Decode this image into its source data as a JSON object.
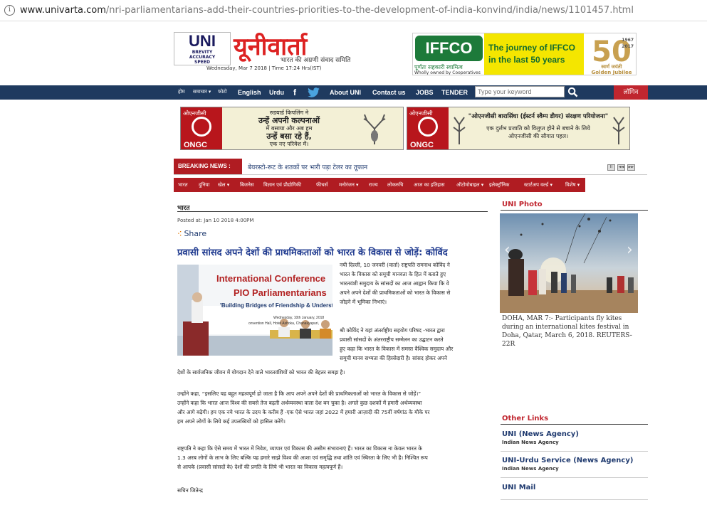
{
  "browser": {
    "url_host": "www.univarta.com",
    "url_path": "/nri-parliamentarians-add-their-countries-priorities-to-the-development-of-india-konvind/india/news/1101457.html"
  },
  "header": {
    "uni_logo": "UNI",
    "uni_slogan_lines": [
      "BREVITY",
      "ACCURACY",
      "SPEED"
    ],
    "hindi_logo": "यूनीवार्ता",
    "hindi_tagline": "भारत की अग्रणी संवाद समिति",
    "date_line": "Wednesday, Mar 7 2018 | Time 17:24 Hrs(IST)"
  },
  "iffco_ad": {
    "logo": "IFFCO",
    "sub1": "पूर्णतः सहकारी स्वामित्व",
    "sub2": "Wholly owned by Cooperatives",
    "headline_line1": "The journey of IFFCO",
    "headline_line2": "in the last 50 years",
    "fifty": "50",
    "year_start": "1967",
    "year_end": "2017",
    "golden_hindi": "स्वर्ण जयंती",
    "golden_en": "Golden Jubilee"
  },
  "nav": {
    "home": "होम",
    "samachar": "समाचार ▾",
    "photo": "फोटो",
    "english": "English",
    "urdu": "Urdu",
    "about": "About UNI",
    "contact": "Contact us",
    "jobs": "JOBS",
    "tender": "TENDER",
    "search_placeholder": "Type your keyword",
    "login": "लॉगिन"
  },
  "ads": {
    "ongc_left_label": "ओएनजीसी",
    "ongc_brand": "ONGC",
    "ongc1_lines": [
      "रुडयार्ड किपलिंग ने",
      "उन्हें अपनी कल्पनाओं",
      "में बसाया और अब हम",
      "उन्हें बसा रहे हैं,",
      "एक नए परिवेश में।"
    ],
    "ongc2_lines": [
      "\"ओएनजीसी बारासिंघा (ईस्टर्न स्वैम्प डीयर) संरक्षण परियोजना\"",
      "एक दुर्लभ प्रजाति को विलुप्त होने से बचाने के लिये",
      "ओएनजीसी की सौगात पहल।"
    ]
  },
  "breaking": {
    "label": "BREAKING NEWS :",
    "text": "बेयरस्टो-रूट के शतकों पर भारी पड़ा टेलर का तूफान",
    "controls": [
      "II",
      "◄◄",
      "►►"
    ]
  },
  "subnav": [
    "भारत",
    "दुनिया",
    "खेल ▾",
    "बिजनेस",
    "विज्ञान एवं प्रौद्योगिकी",
    "फीचर्स",
    "मनोरंजन ▾",
    "राज्य",
    "लोकरुचि",
    "आज का इतिहास",
    "ऑटोमोबाइल ▾",
    "इलेक्ट्रॉनिक",
    "स्टार्टअप वर्ल्ड ▾",
    "विशेष ▾"
  ],
  "article": {
    "section": "भारत",
    "posted": "Posted at: Jan 10 2018 4:00PM",
    "share": "Share",
    "title": "प्रवासी सांसद अपने देशों की प्राथमिकताओं को भारत के विकास से जोड़ें: कोविंद",
    "photo_banner_line1": "International Conference",
    "photo_banner_line2": "PIO Parliamentarians",
    "photo_banner_line3": "'Building Bridges of Friendship & Understa",
    "photo_banner_line4": "Wednesday, 10th January, 2018",
    "photo_banner_line5": "onvention Hall, Hotel Ashoka, Chanakyapuri,",
    "para1_lines": [
      "नयी दिल्ली, 10 जनवरी (वार्ता) राष्ट्रपति रामनाथ कोविंद ने",
      "भारत के विकास को समूची मानवता के हित में बताते हुए",
      "भारतवंशी समुदाय के सांसदों का आज आह्वान किया कि वे",
      "अपने अपने देशों की प्राथमिकताओं को भारत के विकास से",
      "जोड़ने में भूमिका निभाएं।"
    ],
    "para2_lines": [
      "श्री कोविंद ने यहां अंतर्राष्ट्रीय सहयोग परिषद -भारत द्वारा",
      "प्रवासी सांसदों के अंतरराष्ट्रीय सम्मेलन का उद्घाटन करते",
      "हुए कहा कि भारत के विकास में समस्त वैश्विक समुदाय और",
      "समूची मानव सभ्यता की हिस्सेदारी है। सांसद होकर अपने"
    ],
    "para2_last": "देशों के सार्वजनिक जीवन में योगदान देने वाले भारतवंशियों को भारत की बेहतर समझ है।",
    "para3_lines": [
      "उन्होंने कहा, “इसलिए यह बहुत महत्वपूर्ण हो जाता है कि आप अपने अपने देशों की प्राथमिकताओं को भारत के विकास से जोड़ें।”",
      "उन्होंने कहा कि भारत आज विश्व की सबसे तेज बढ़ती अर्थव्यवस्था वाला देश बन चुका है। अगले कुछ दशकों में हमारी अर्थव्यवस्था",
      "और आगे बढ़ेगी। हम एक नये भारत के उदय के करीब हैं -एक ऐसे भारत जहां 2022 में हमारी आज़ादी की 75वीं वर्षगांठ के मौके पर",
      "हम अपने लोगों के लिये कई उपलब्धियों को हासिल करेंगे।"
    ],
    "para4_lines": [
      "राष्ट्रपति ने कहा कि ऐसे समय में भारत में निवेश, व्यापार एवं विकास की असीम संभावनाएं हैं। भारत का विकास ना केवल भारत के",
      "1.3 अरब लोगों के लाभ के लिए बल्कि यह हमारे साझे विश्व की आशा एवं समृद्धि तथा शांति एवं स्थिरता के लिए भी है। निश्चित रूप",
      "से आपके (प्रवासी सांसदों के) देशों की प्रगति के लिये भी भारत का विकास महत्वपूर्ण हैं।"
    ],
    "byline": "सचिन जितेन्द्र"
  },
  "sidebar": {
    "uni_photo_heading": "UNI Photo",
    "photo_caption": "DOHA, MAR 7:- Participants fly kites during an international kites festival in Doha, Qatar, March 6, 2018. REUTERS-22R",
    "other_links_heading": "Other Links",
    "links": [
      {
        "title": "UNI (News Agency)",
        "sub": "Indian News Agency"
      },
      {
        "title": "UNI-Urdu Service (News Agency)",
        "sub": "Indian News Agency"
      },
      {
        "title": "UNI Mail",
        "sub": ""
      }
    ]
  },
  "colors": {
    "nav_bg": "#1f3a5f",
    "accent_red": "#b01c22",
    "link_blue": "#1f3a6f"
  }
}
